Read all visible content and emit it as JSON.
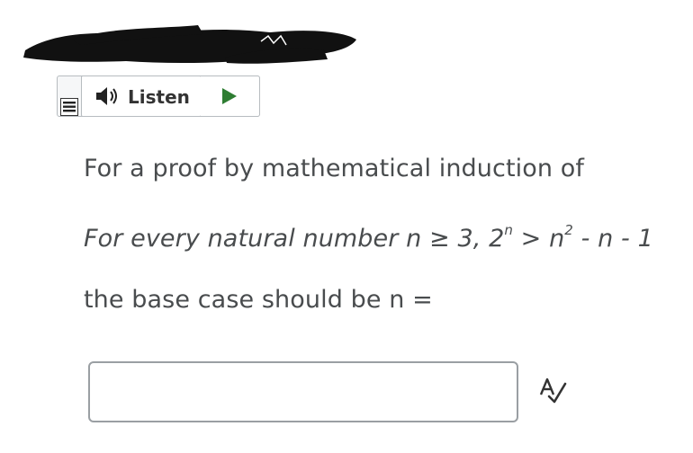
{
  "header": {
    "redacted_title": true
  },
  "listen_toolbar": {
    "menu_icon": "menu-lines-icon",
    "speaker_icon": "speaker-icon",
    "listen_label": "Listen",
    "play_icon": "play-triangle-icon",
    "play_color": "#2e7d32"
  },
  "question": {
    "line1": "For a proof by mathematical induction of",
    "statement": {
      "before": "For every natural number n ≥ 3, 2",
      "exp1": "n",
      "middle": " > n",
      "exp2": "2",
      "after": " - n - 1"
    },
    "line3": "the base case should be n ="
  },
  "answer": {
    "value": "",
    "placeholder": ""
  },
  "tools": {
    "spellcheck_icon": "spellcheck-icon"
  }
}
